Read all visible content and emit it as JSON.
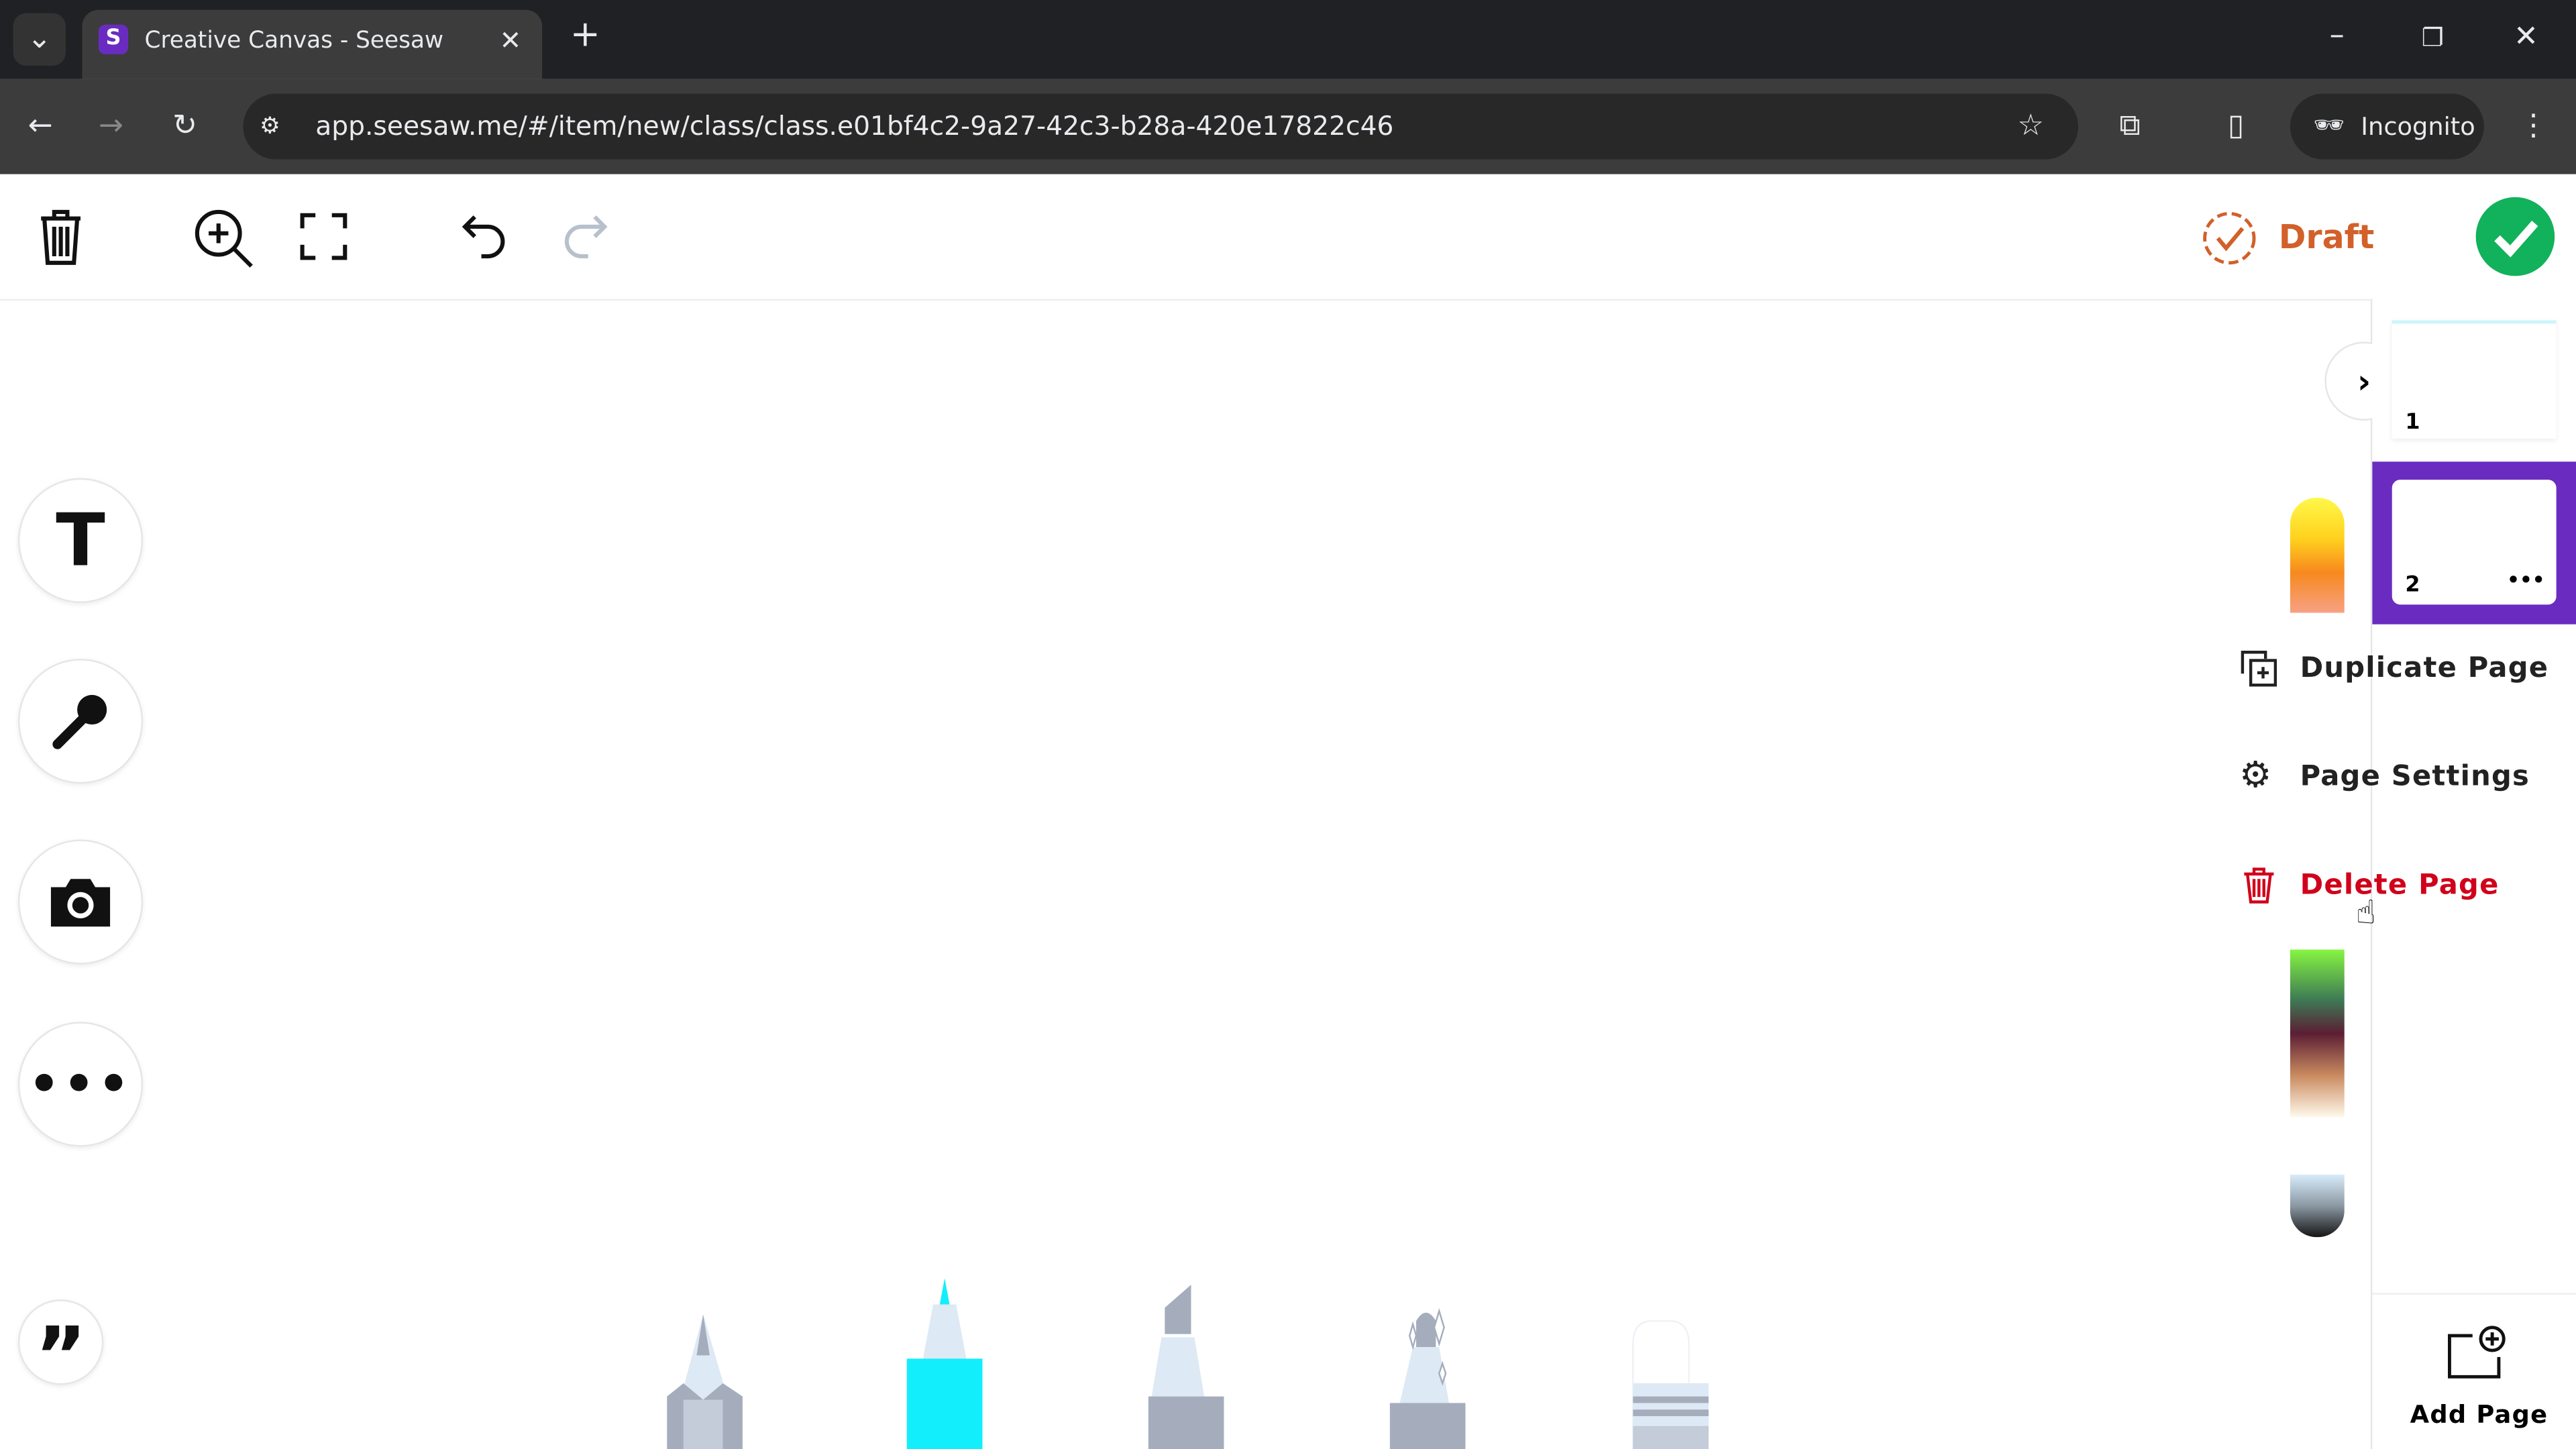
{
  "browser": {
    "tab_title": "Creative Canvas - Seesaw",
    "url": "app.seesaw.me/#/item/new/class/class.e01bf4c2-9a27-42c3-b28a-420e17822c46",
    "profile": "Incognito"
  },
  "toolbar": {
    "draft_label": "Draft",
    "colors": {
      "draft": "#d2602a",
      "done": "#12b15b"
    }
  },
  "pages": {
    "items": [
      {
        "number": "1"
      },
      {
        "number": "2",
        "selected": true,
        "more": "•••"
      }
    ],
    "accent": "#6a2cc0",
    "add_label": "Add Page"
  },
  "page_menu": {
    "items": [
      {
        "label": "Duplicate Page",
        "icon": "duplicate-icon"
      },
      {
        "label": "Page Settings",
        "icon": "gear-icon"
      },
      {
        "label": "Delete Page",
        "icon": "trash-icon",
        "color": "#d0021b"
      }
    ]
  },
  "left_tools": [
    "text-tool",
    "microphone-tool",
    "camera-tool",
    "more-tools",
    "quote-tool"
  ],
  "drawing_tools": [
    {
      "name": "pencil"
    },
    {
      "name": "marker",
      "selected": true,
      "color": "#13eefc"
    },
    {
      "name": "highlighter"
    },
    {
      "name": "glitter-pen"
    },
    {
      "name": "eraser"
    }
  ]
}
